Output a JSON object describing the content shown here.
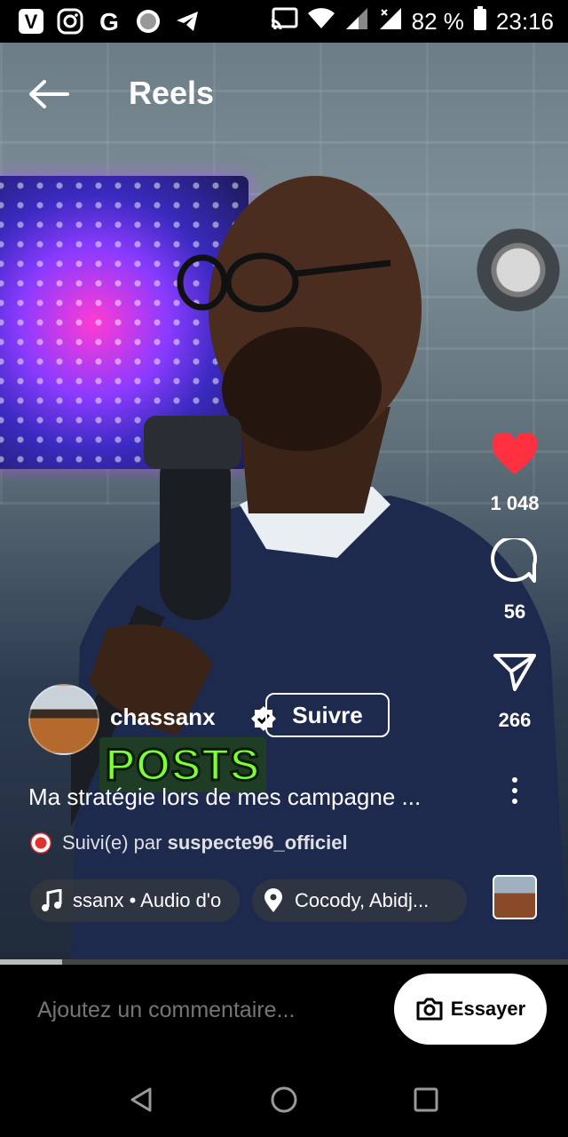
{
  "status_bar": {
    "icons": [
      "v-icon",
      "instagram-icon",
      "google-icon",
      "circle-app-icon",
      "telegram-icon"
    ],
    "battery_percent": "82 %",
    "time": "23:16"
  },
  "header": {
    "title": "Reels"
  },
  "actions": {
    "likes": "1 048",
    "comments": "56",
    "shares": "266"
  },
  "post": {
    "username": "chassanx",
    "follow_label": "Suivre",
    "sticker_text": "POSTS",
    "caption": "Ma stratégie lors de mes campagne ...",
    "followed_prefix": "Suivi(e) par",
    "followed_user": "suspecte96_officiel",
    "music_text": "ssanx • Audio d'o",
    "location_text": "Cocody, Abidj..."
  },
  "progress": {
    "fraction": 0.11
  },
  "comment_bar": {
    "placeholder": "Ajoutez un commentaire...",
    "try_label": "Essayer"
  },
  "colors": {
    "like": "#ff3040",
    "sticker_text": "#7dff36"
  }
}
